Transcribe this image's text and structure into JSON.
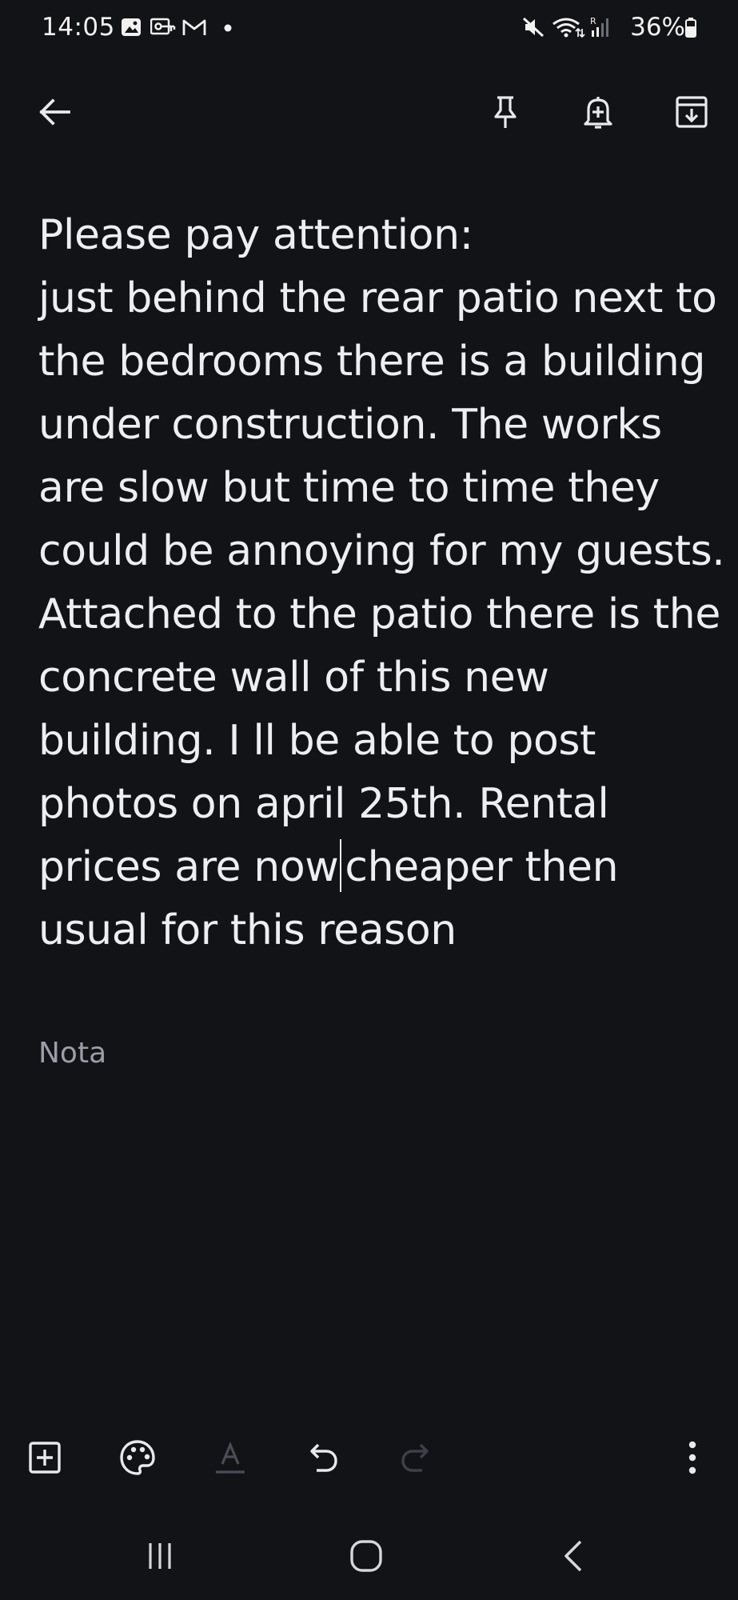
{
  "status_bar": {
    "time": "14:05",
    "battery_percent": "36%",
    "icons": [
      "gallery-icon",
      "vpn-key-icon",
      "gmail-icon",
      "notification-dot-icon",
      "mute-icon",
      "wifi-icon",
      "signal-icon",
      "battery-icon"
    ]
  },
  "toolbar": {
    "icons": [
      "back-arrow-icon",
      "pin-icon",
      "reminder-bell-icon",
      "archive-icon"
    ]
  },
  "note": {
    "text_before_caret": "Please pay attention:\njust behind the rear patio next to the bedrooms there is a building under construction. The works are slow but time to time they could be annoying for my guests. Attached to the patio there is the concrete wall of this new building. I ll be able to post photos on april 25th. Rental prices are now",
    "text_after_caret": "cheaper then usual for this reason",
    "label": "Nota"
  },
  "edit_bar": {
    "icons": [
      "add-box-icon",
      "palette-icon",
      "text-format-icon",
      "undo-icon",
      "redo-icon",
      "more-vert-icon"
    ]
  },
  "nav_bar": {
    "icons": [
      "recents-icon",
      "home-icon",
      "back-icon"
    ]
  },
  "colors": {
    "background": "#121317",
    "text": "#eceef1",
    "muted": "#9b9ea6",
    "disabled": "#4a4d55"
  }
}
